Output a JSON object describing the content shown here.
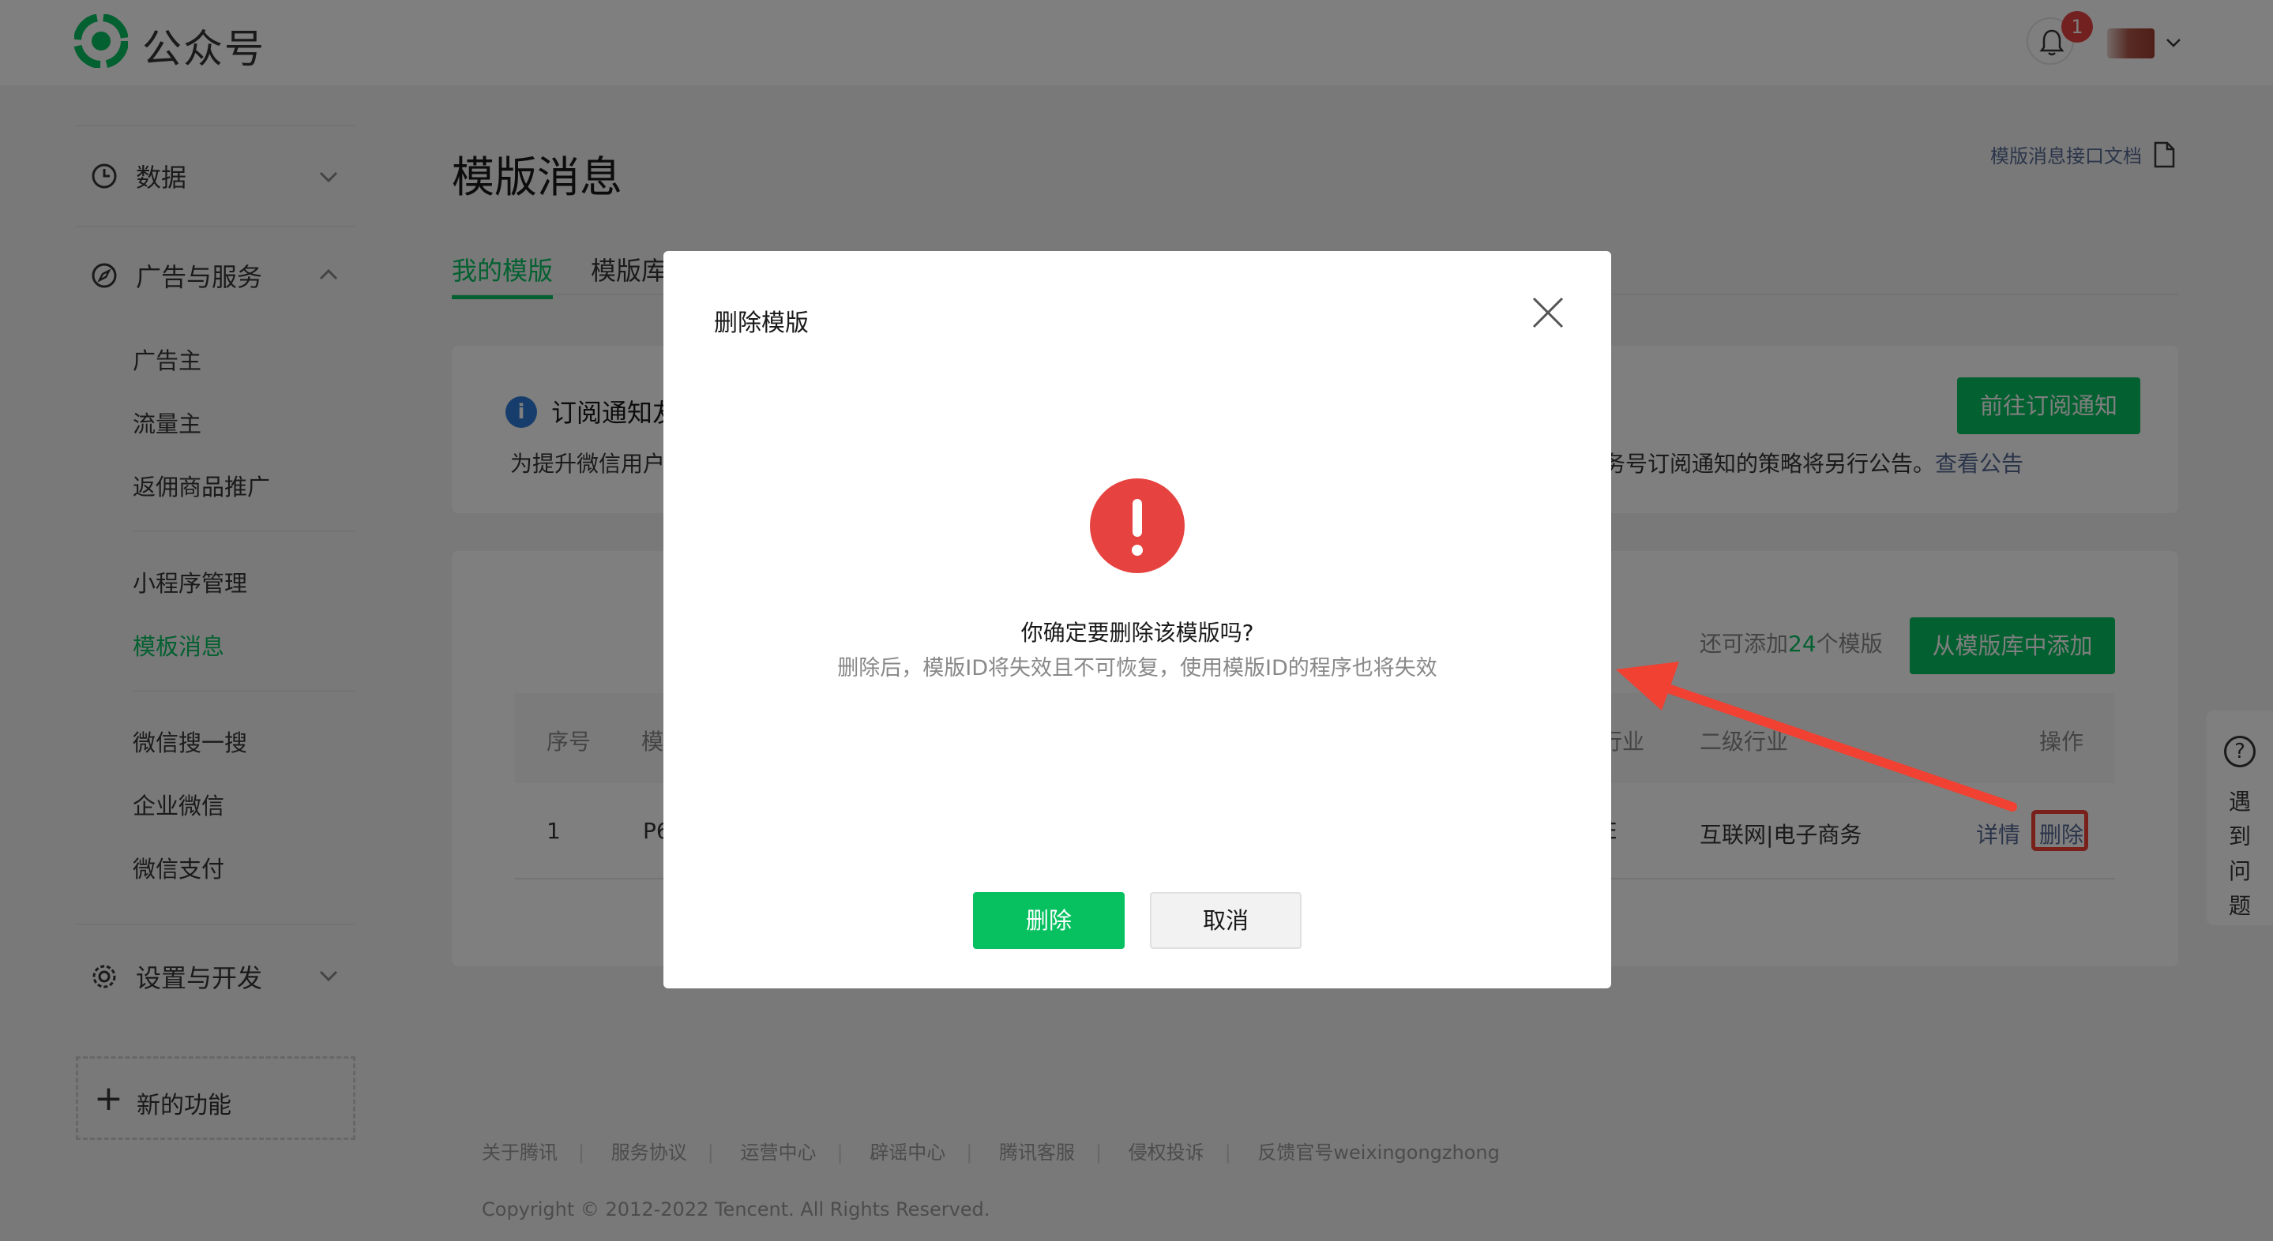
{
  "header": {
    "brand": "公众号",
    "notification_count": "1"
  },
  "sidebar": {
    "groups": [
      {
        "label": "数据",
        "icon": "clock-icon"
      },
      {
        "label": "广告与服务",
        "icon": "compass-icon"
      },
      {
        "label": "设置与开发",
        "icon": "gear-icon"
      }
    ],
    "items": [
      {
        "label": "广告主"
      },
      {
        "label": "流量主"
      },
      {
        "label": "返佣商品推广"
      },
      {
        "label": "小程序管理"
      },
      {
        "label": "模板消息",
        "active": true
      },
      {
        "label": "微信搜一搜"
      },
      {
        "label": "企业微信"
      },
      {
        "label": "微信支付"
      }
    ],
    "new_feature": "新的功能"
  },
  "main": {
    "title": "模版消息",
    "doc_link": "模版消息接口文档",
    "tabs": [
      {
        "label": "我的模版",
        "active": true
      },
      {
        "label": "模版库"
      }
    ],
    "notice": {
      "title": "订阅通知友",
      "text_left": "为提升微信用户",
      "text_right": "务号订阅通知的策略将另行公告。",
      "link": "查看公告",
      "button": "前往订阅通知"
    },
    "remain_prefix": "还可添加",
    "remain_count": "24",
    "remain_suffix": "个模版",
    "add_button": "从模版库中添加",
    "table": {
      "headers": [
        "序号",
        "模",
        "行业",
        "二级行业",
        "操作"
      ],
      "rows": [
        {
          "index": "1",
          "template": "P6",
          "industry": "E",
          "sub_industry": "互联网|电子商务",
          "detail": "详情",
          "delete": "删除"
        }
      ]
    }
  },
  "footer": {
    "links": [
      "关于腾讯",
      "服务协议",
      "运营中心",
      "辟谣中心",
      "腾讯客服",
      "侵权投诉",
      "反馈官号weixingongzhong"
    ],
    "copyright": "Copyright © 2012-2022 Tencent. All Rights Reserved."
  },
  "help": {
    "label": "遇到问题"
  },
  "modal": {
    "title": "删除模版",
    "question": "你确定要删除该模版吗?",
    "description": "删除后，模版ID将失效且不可恢复，使用模版ID的程序也将失效",
    "confirm": "删除",
    "cancel": "取消"
  },
  "colors": {
    "brand_green": "#07c160",
    "link_blue": "#576b95",
    "warning_red": "#e64340",
    "annotation_red": "#f04132"
  }
}
